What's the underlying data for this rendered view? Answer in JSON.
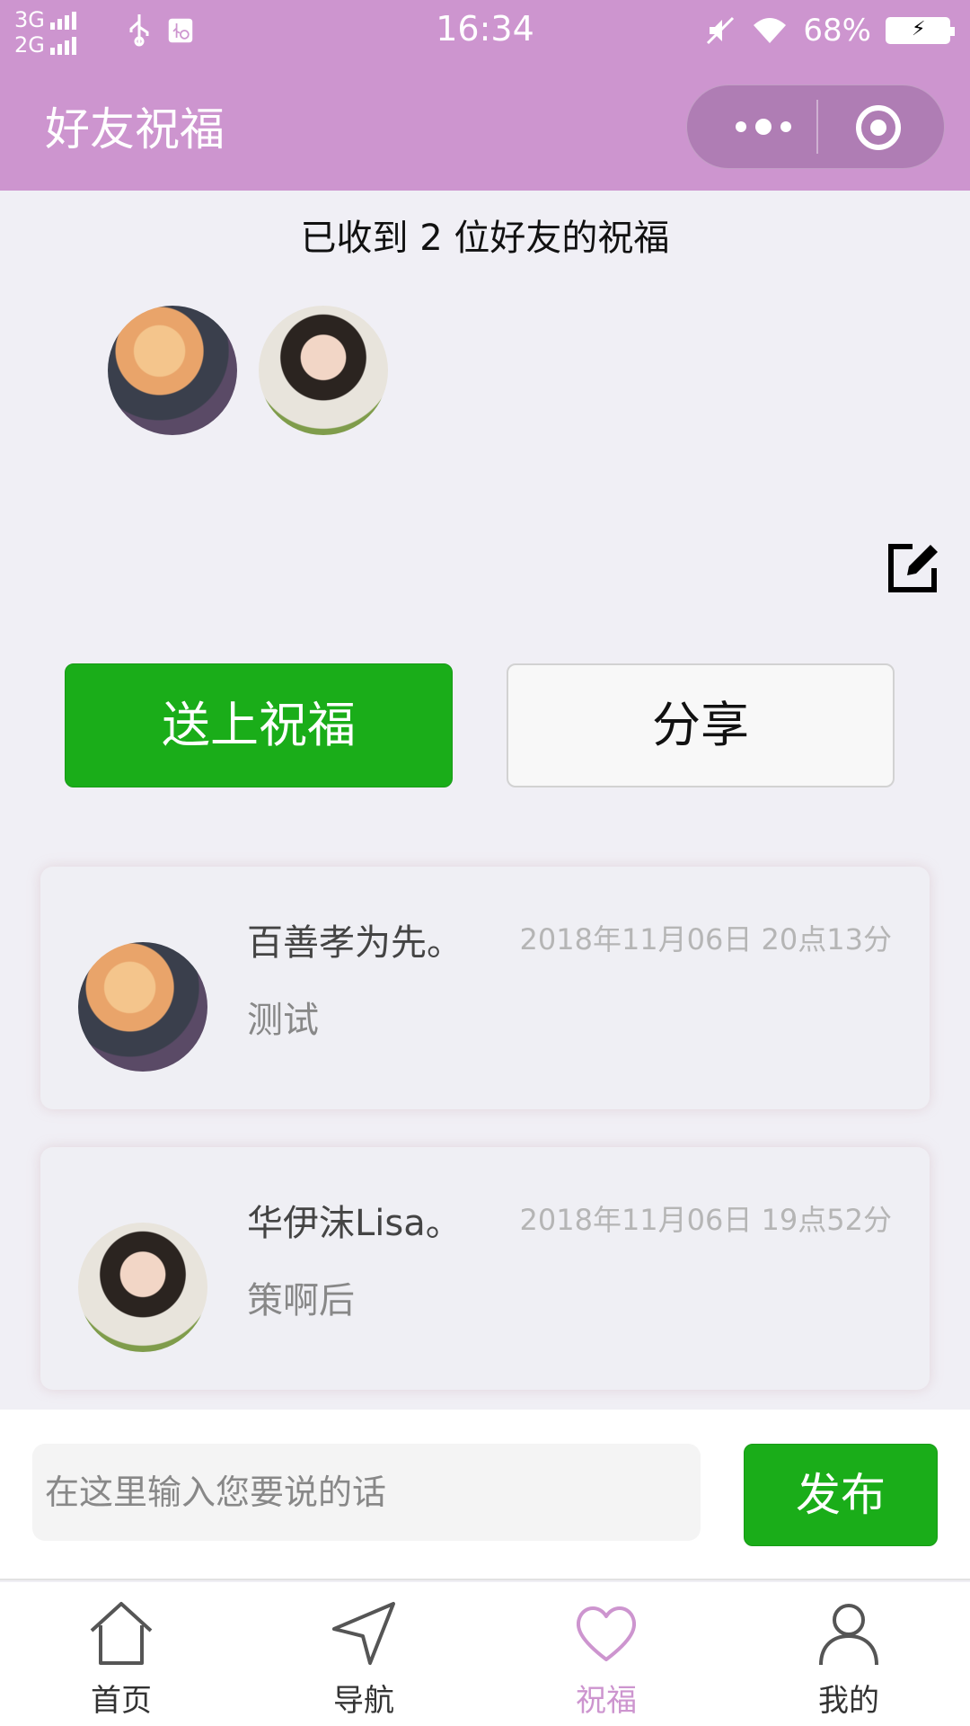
{
  "status_bar": {
    "network_top": "3G",
    "network_bottom": "2G",
    "time": "16:34",
    "battery": "68%"
  },
  "nav": {
    "title": "好友祝福"
  },
  "summary": {
    "text": "已收到 2 位好友的祝福"
  },
  "actions": {
    "send_blessing": "送上祝福",
    "share": "分享"
  },
  "messages": [
    {
      "name": "百善孝为先。",
      "date": "2018年11月06日 20点13分",
      "text": "测试"
    },
    {
      "name": "华伊沫Lisa。",
      "date": "2018年11月06日 19点52分",
      "text": "策啊后"
    }
  ],
  "composer": {
    "placeholder": "在这里输入您要说的话",
    "publish": "发布"
  },
  "tabs": [
    {
      "label": "首页",
      "icon": "home-icon"
    },
    {
      "label": "导航",
      "icon": "navigation-icon"
    },
    {
      "label": "祝福",
      "icon": "heart-icon",
      "active": true
    },
    {
      "label": "我的",
      "icon": "user-icon"
    }
  ],
  "colors": {
    "theme": "#cd95cf",
    "primary_green": "#1aad19",
    "background": "#f0eff5"
  }
}
